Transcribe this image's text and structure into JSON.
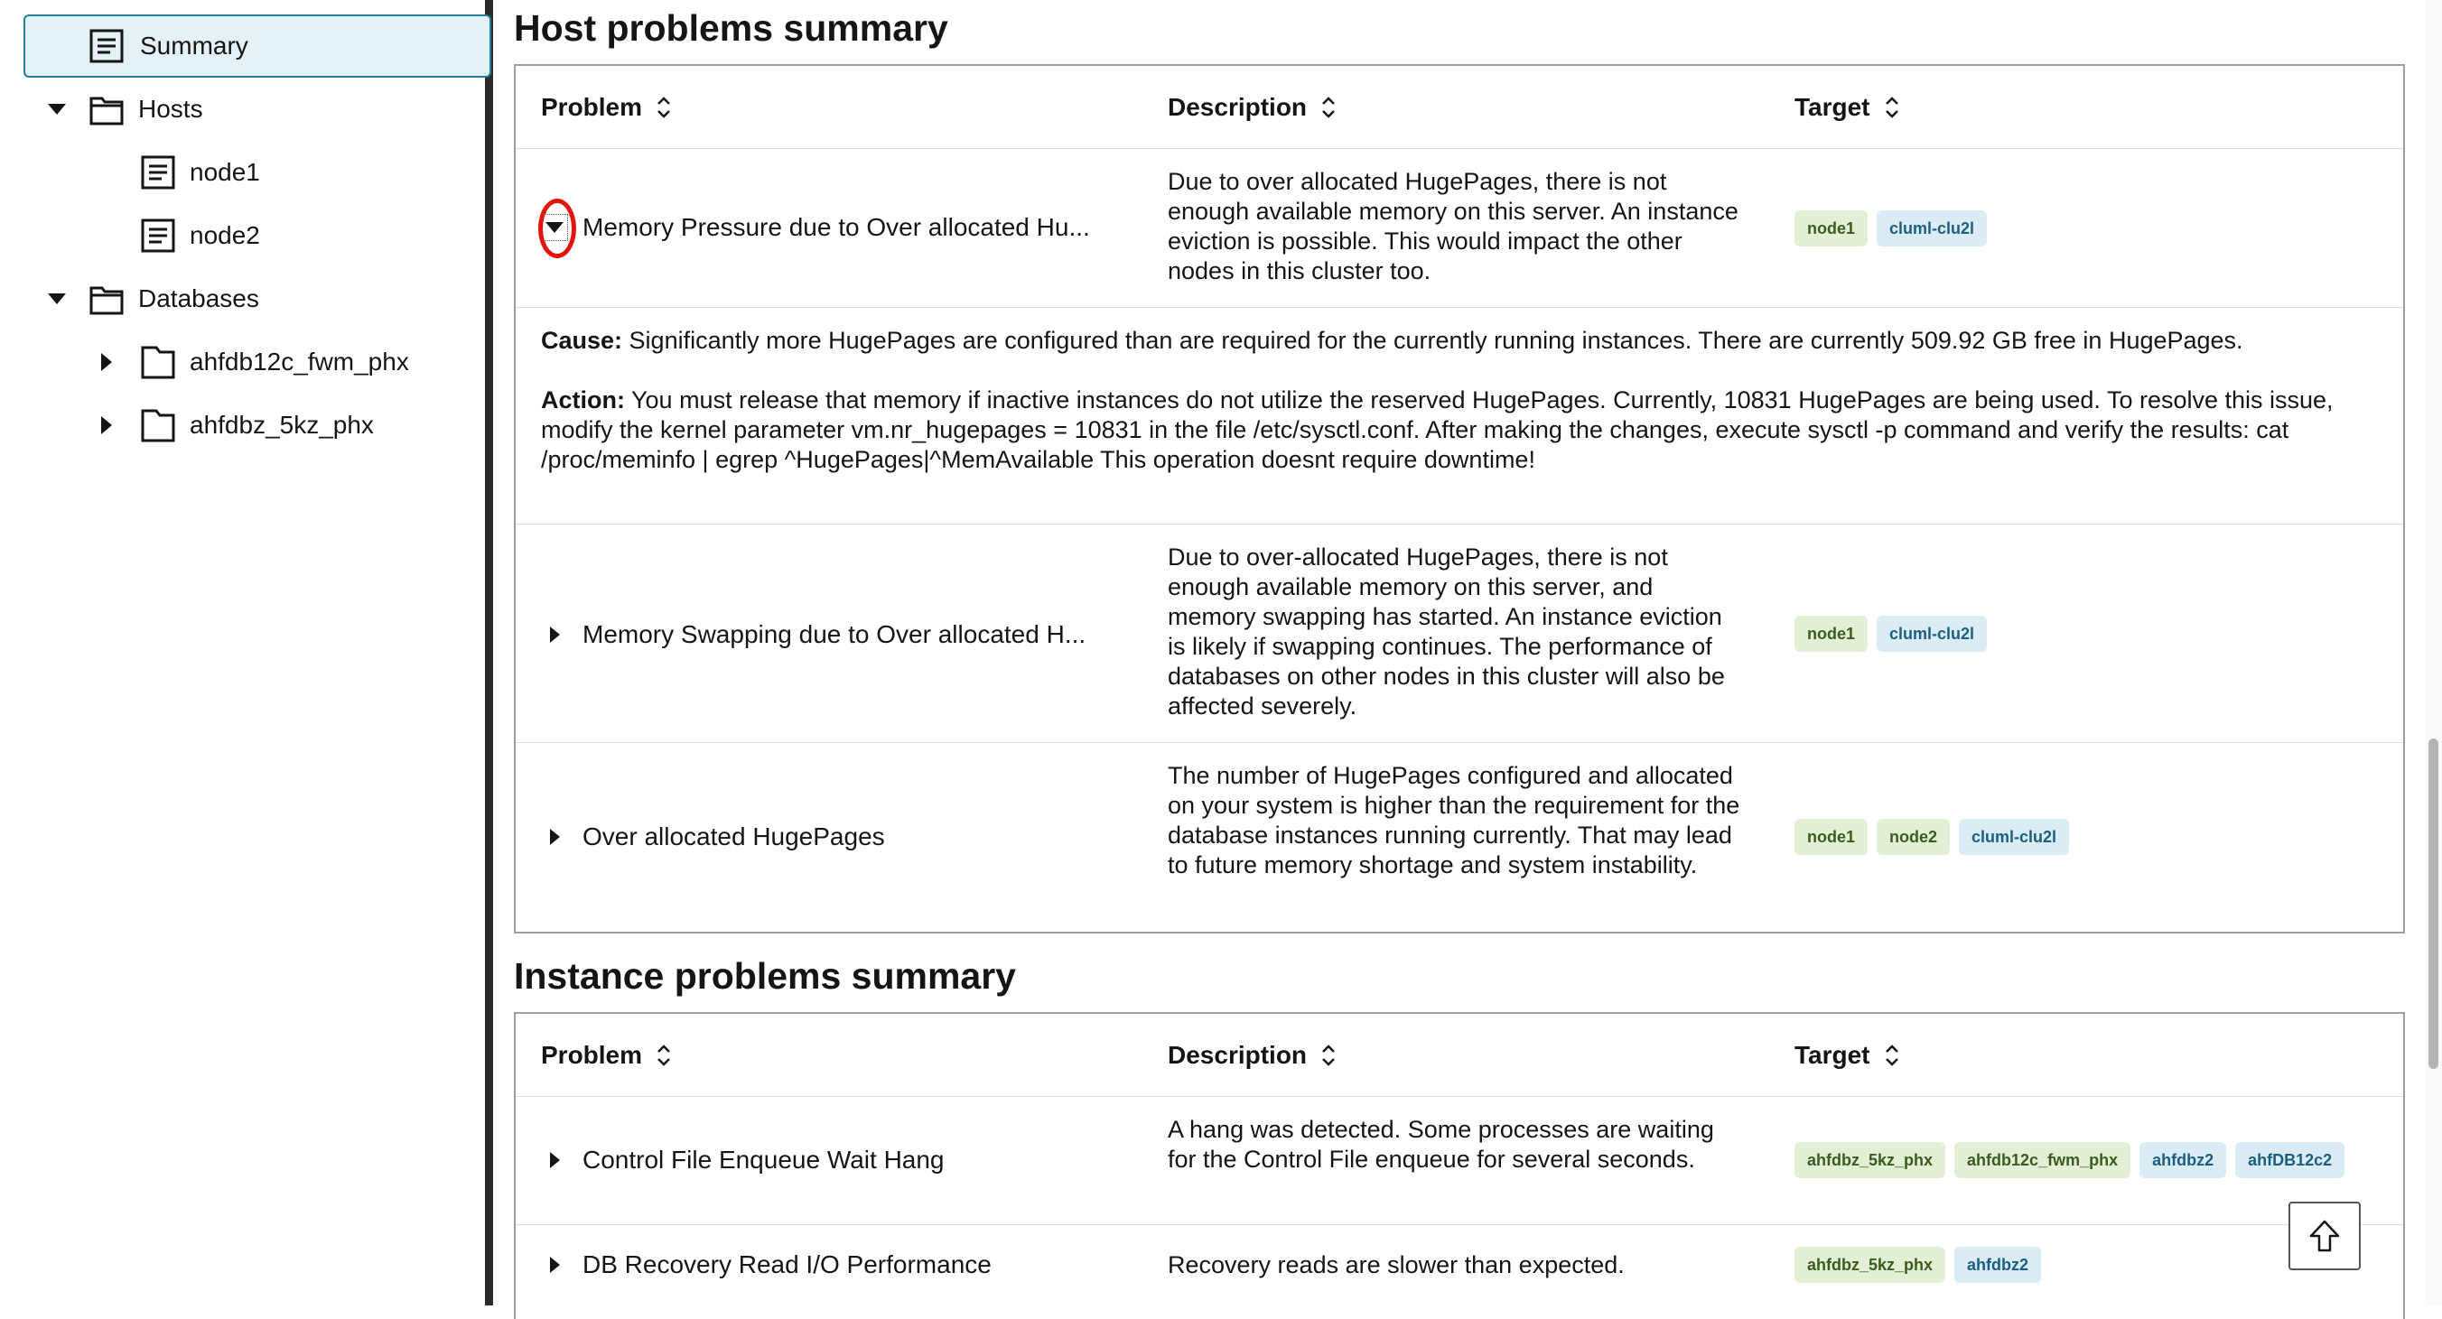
{
  "sidebar": {
    "items": [
      {
        "label": "Summary",
        "icon": "document-icon",
        "selected": true
      },
      {
        "label": "Hosts",
        "icon": "folder-icon",
        "expanded": true
      },
      {
        "label": "node1",
        "icon": "document-icon"
      },
      {
        "label": "node2",
        "icon": "document-icon"
      },
      {
        "label": "Databases",
        "icon": "folder-icon",
        "expanded": true
      },
      {
        "label": "ahfdb12c_fwm_phx",
        "icon": "folder-icon",
        "expanded": false
      },
      {
        "label": "ahfdbz_5kz_phx",
        "icon": "folder-icon",
        "expanded": false
      }
    ]
  },
  "host_section": {
    "title": "Host problems summary",
    "columns": [
      "Problem",
      "Description",
      "Target"
    ],
    "rows": [
      {
        "problem": "Memory Pressure due to Over allocated Hu...",
        "description": "Due to over allocated HugePages, there is not enough available memory on this server. An instance eviction is possible. This would impact the other nodes in this cluster too.",
        "targets": [
          "node1",
          "cluml-clu2l"
        ],
        "expanded": true,
        "cause_label": "Cause:",
        "cause": "Significantly more HugePages are configured than are required for the currently running instances. There are currently 509.92 GB free in HugePages.",
        "action_label": "Action:",
        "action": "You must release that memory if inactive instances do not utilize the reserved HugePages. Currently, 10831 HugePages are being used. To resolve this issue, modify the kernel parameter vm.nr_hugepages = 10831 in the file /etc/sysctl.conf. After making the changes, execute sysctl -p command and verify the results: cat /proc/meminfo | egrep ^HugePages|^MemAvailable This operation doesnt require downtime!"
      },
      {
        "problem": "Memory Swapping due to Over allocated H...",
        "description": "Due to over-allocated HugePages, there is not enough available memory on this server, and memory swapping has started. An instance eviction is likely if swapping continues. The performance of databases on other nodes in this cluster will also be affected severely.",
        "targets": [
          "node1",
          "cluml-clu2l"
        ]
      },
      {
        "problem": "Over allocated HugePages",
        "description": "The number of HugePages configured and allocated on your system is higher than the requirement for the database instances running currently. That may lead to future memory shortage and system instability.",
        "targets": [
          "node1",
          "node2",
          "cluml-clu2l"
        ]
      }
    ]
  },
  "instance_section": {
    "title": "Instance problems summary",
    "columns": [
      "Problem",
      "Description",
      "Target"
    ],
    "rows": [
      {
        "problem": "Control File Enqueue Wait Hang",
        "description": "A hang was detected. Some processes are waiting for the Control File enqueue for several seconds.",
        "targets": [
          "ahfdbz_5kz_phx",
          "ahfdb12c_fwm_phx",
          "ahfdbz2",
          "ahfDB12c2"
        ]
      },
      {
        "problem": "DB Recovery Read I/O Performance",
        "description": "Recovery reads are slower than expected.",
        "targets": [
          "ahfdbz_5kz_phx",
          "ahfdbz2"
        ]
      }
    ]
  },
  "colors": {
    "selected_bg": "#e4f1f7",
    "selected_border": "#227e9e",
    "chip_green_bg": "#e3f0d6",
    "chip_blue_bg": "#dcecf5",
    "highlight_ring": "#e3140b"
  }
}
